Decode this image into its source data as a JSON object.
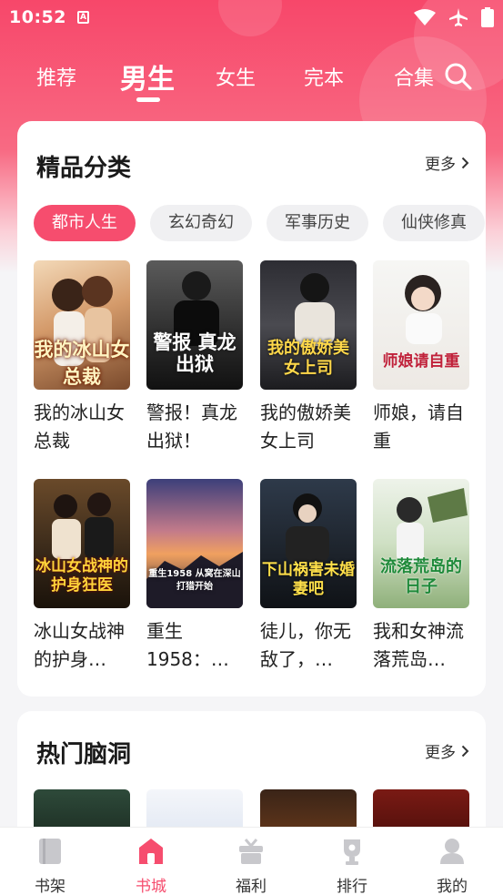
{
  "status_bar": {
    "time": "10:52",
    "app_badge": "A"
  },
  "tabs": [
    {
      "label": "推荐"
    },
    {
      "label": "男生"
    },
    {
      "label": "女生"
    },
    {
      "label": "完本"
    },
    {
      "label": "合集"
    }
  ],
  "featured": {
    "title": "精品分类",
    "more": "更多",
    "categories": [
      "都市人生",
      "玄幻奇幻",
      "军事历史",
      "仙侠修真"
    ],
    "books": [
      {
        "title": "我的冰山女总裁",
        "cover_text": "我的冰山女总裁"
      },
      {
        "title": "警报！真龙出狱！",
        "cover_text": "警报 真龙出狱"
      },
      {
        "title": "我的傲娇美女上司",
        "cover_text": "我的傲娇美女上司"
      },
      {
        "title": "师娘，请自重",
        "cover_text": "师娘请自重"
      },
      {
        "title": "冰山女战神的护身…",
        "cover_text": "冰山女战神的护身狂医"
      },
      {
        "title": "重生1958：…",
        "cover_text": "重生1958 从窝在深山打猎开始"
      },
      {
        "title": "徒儿，你无敌了，…",
        "cover_text": "下山祸害未婚妻吧"
      },
      {
        "title": "我和女神流落荒岛…",
        "cover_text": "流落荒岛的日子"
      }
    ]
  },
  "hot": {
    "title": "热门脑洞",
    "more": "更多"
  },
  "bottom_nav": [
    {
      "label": "书架",
      "icon": "bookshelf-icon"
    },
    {
      "label": "书城",
      "icon": "bookstore-icon"
    },
    {
      "label": "福利",
      "icon": "gift-icon"
    },
    {
      "label": "排行",
      "icon": "trophy-icon"
    },
    {
      "label": "我的",
      "icon": "profile-icon"
    }
  ],
  "colors": {
    "accent": "#f64d6e",
    "header": "#f7476a"
  }
}
